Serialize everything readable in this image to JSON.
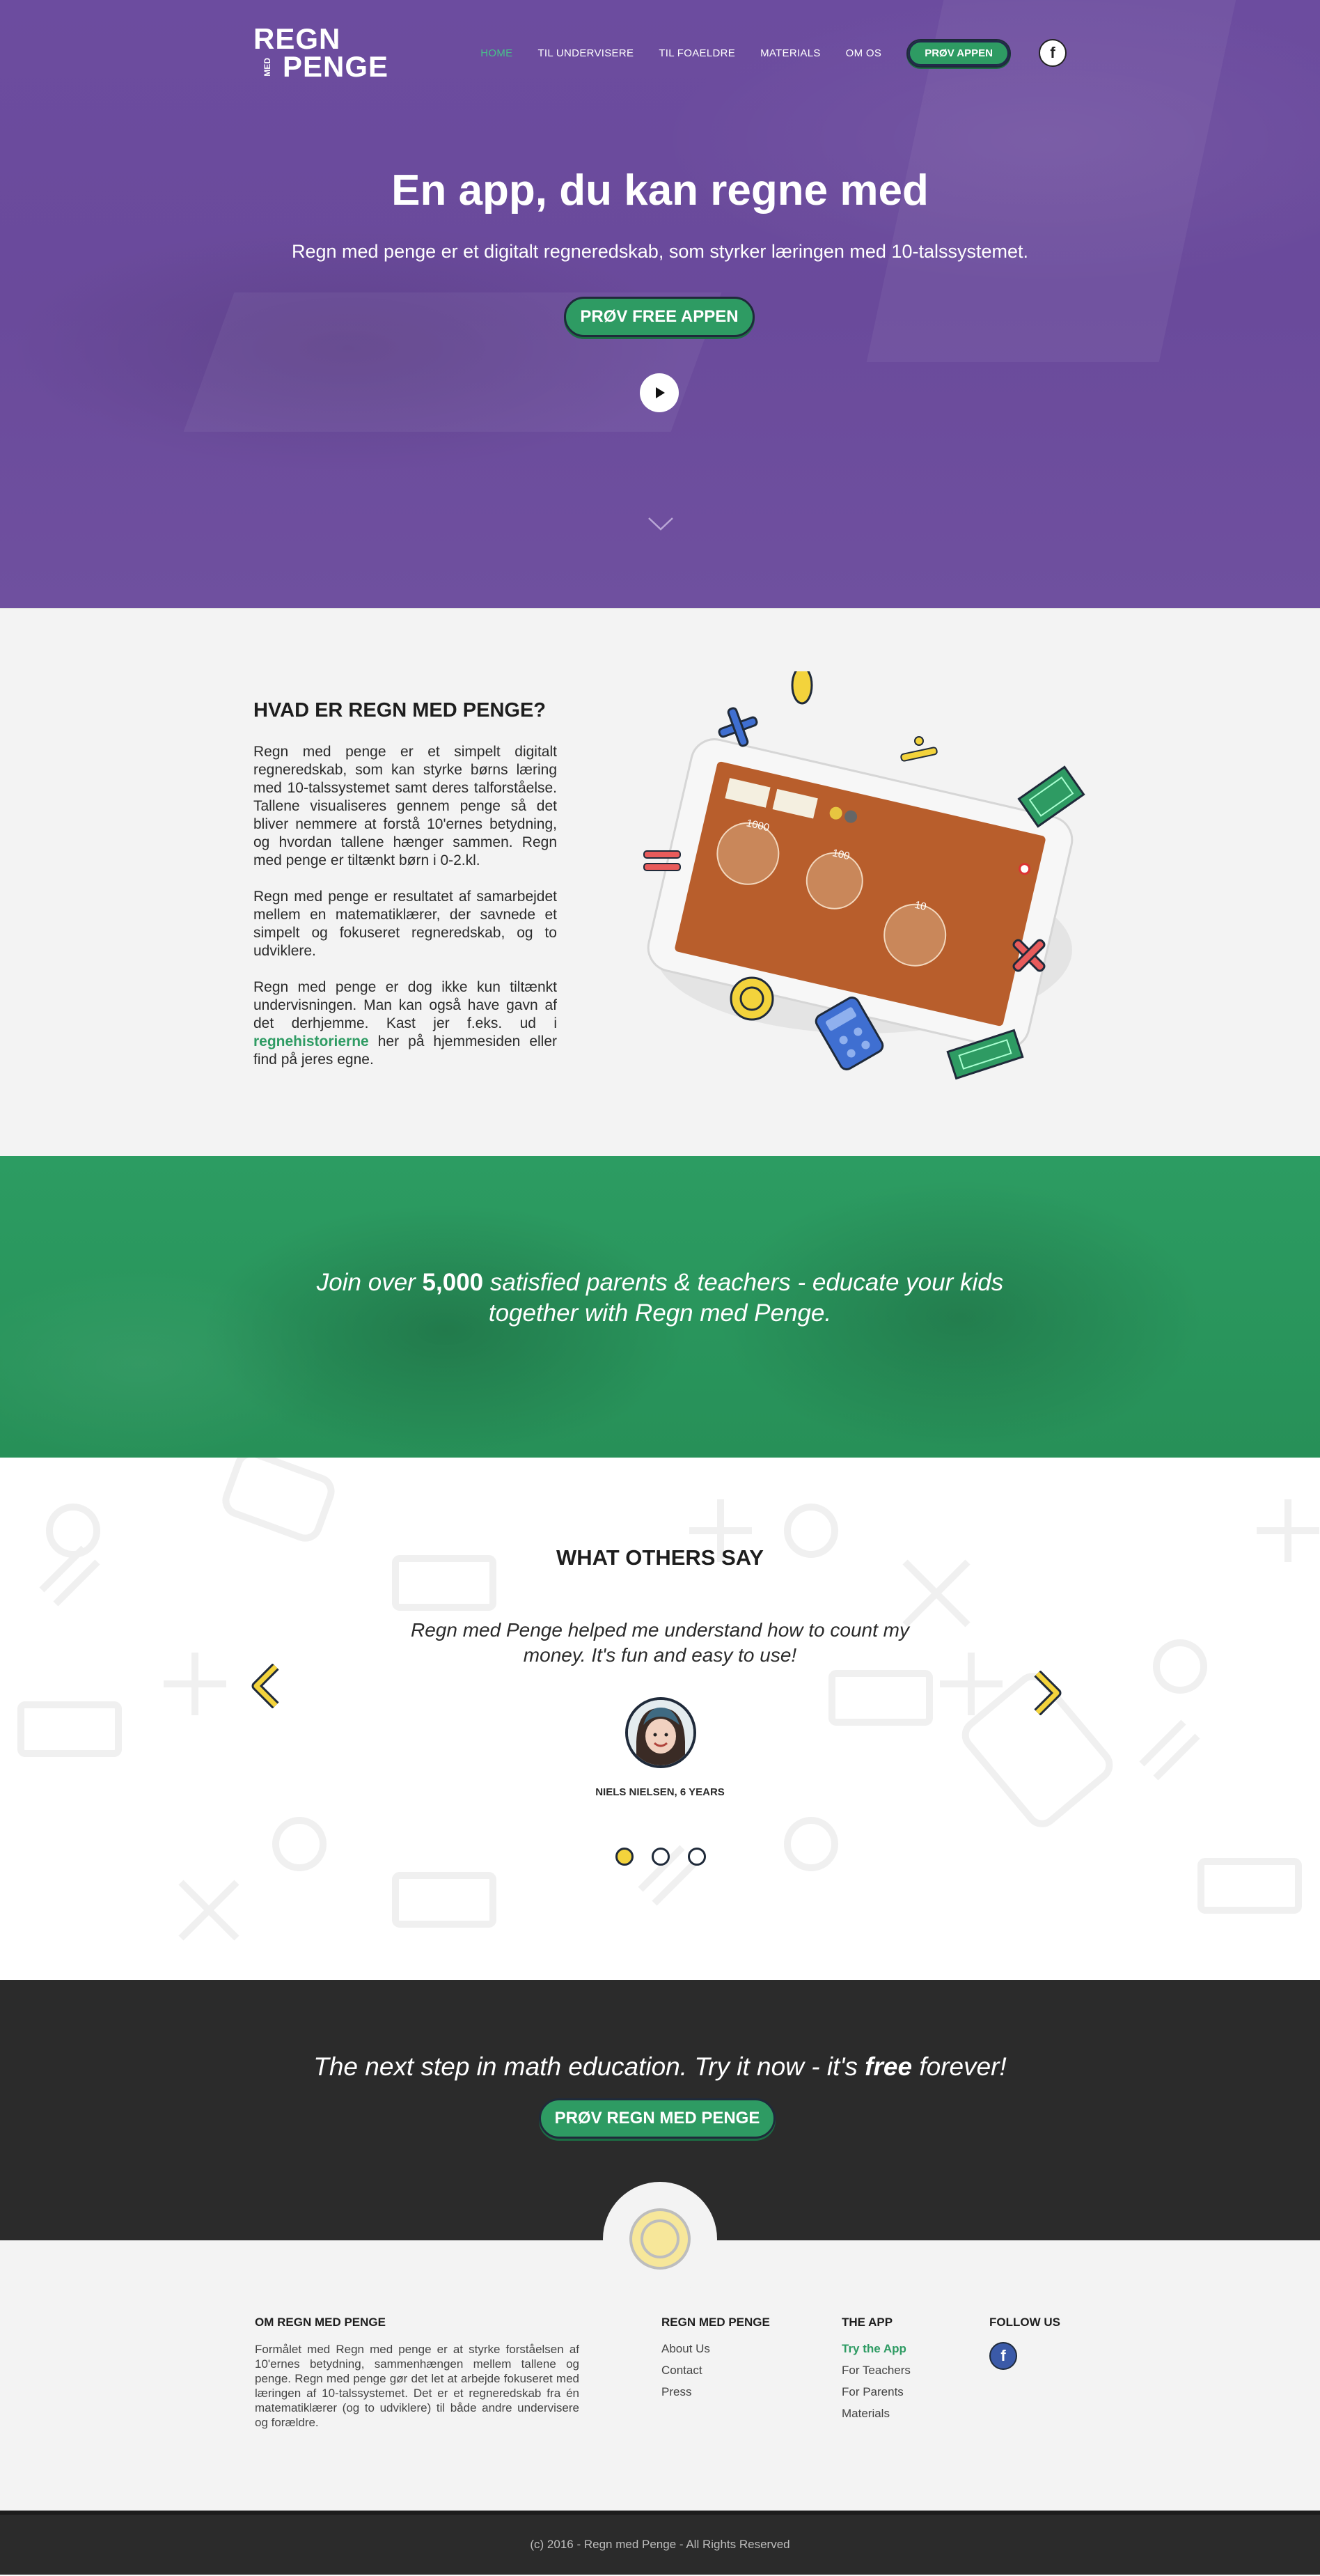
{
  "nav": {
    "logo_top": "REGN",
    "logo_med": "MED",
    "logo_bottom": "PENGE",
    "links": [
      "HOME",
      "TIL UNDERVISERE",
      "TIL FOAELDRE",
      "MATERIALS",
      "OM OS"
    ],
    "cta": "PRØV APPEN",
    "social_letter": "f"
  },
  "hero": {
    "title_pre": "En app, du kan ",
    "title_bold": "regne",
    "title_post": " med",
    "subtitle": "Regn med penge er et digitalt regneredskab, som styrker læringen med 10-talssystemet.",
    "cta": "PRØV FREE APPEN"
  },
  "about": {
    "title": "HVAD ER REGN MED PENGE?",
    "p1": "Regn med penge er et simpelt digitalt regneredskab, som kan styrke børns læring med 10-talssystemet samt deres talforståelse. Tallene visualiseres gennem penge så det bliver nemmere at forstå 10'ernes betydning, og hvordan tallene hænger sammen. Regn med penge er tiltænkt børn i 0-2.kl.",
    "p2": "Regn med penge er resultatet af samarbejdet mellem en matematiklærer, der savnede et simpelt og fokuseret regneredskab, og to udviklere.",
    "p3_pre": "Regn med penge er dog ikke kun tiltænkt undervisningen. Man kan også have gavn af det derhjemme. Kast jer f.eks. ud i ",
    "p3_link": "regnehistorierne",
    "p3_post": " her på hjemmesiden eller find på jeres egne.",
    "tablet_labels": [
      "1000",
      "100",
      "10"
    ]
  },
  "banner": {
    "pre": "Join over ",
    "bold": "5,000",
    "post": " satisfied parents & teachers - educate your kids",
    "line2": "together with Regn med Penge."
  },
  "testimonials": {
    "title": "WHAT OTHERS SAY",
    "quote": "Regn med Penge helped me understand how to count my money. It's fun and easy to use!",
    "author": "NIELS NIELSEN, 6 YEARS",
    "active_index": 0,
    "count": 3
  },
  "cta": {
    "text_pre": "The next step in math education. Try it now - it's ",
    "text_bold": "free",
    "text_post": " forever!",
    "button": "PRØV REGN MED PENGE"
  },
  "footer": {
    "about_title": "OM REGN MED PENGE",
    "about_text": "Formålet med Regn med penge er at styrke forståelsen af 10'ernes betydning, sammenhængen mellem tallene og penge. Regn med penge gør det let at arbejde fokuseret med læringen af 10-talssystemet. Det er et regneredskab fra én matematiklærer (og to udviklere) til både andre undervisere og forældre.",
    "col2_title": "REGN MED PENGE",
    "col2_items": [
      "About Us",
      "Contact",
      "Press"
    ],
    "col3_title": "THE APP",
    "col3_items": [
      "Try the App",
      "For Teachers",
      "For Parents",
      "Materials"
    ],
    "col4_title": "FOLLOW US",
    "copyright": "(c)  2016 - Regn med Penge  - All Rights Reserved"
  },
  "colors": {
    "purple": "#6a4a9c",
    "green": "#2e9b63",
    "yellow": "#f3d33c",
    "dark": "#2b2b2b"
  }
}
